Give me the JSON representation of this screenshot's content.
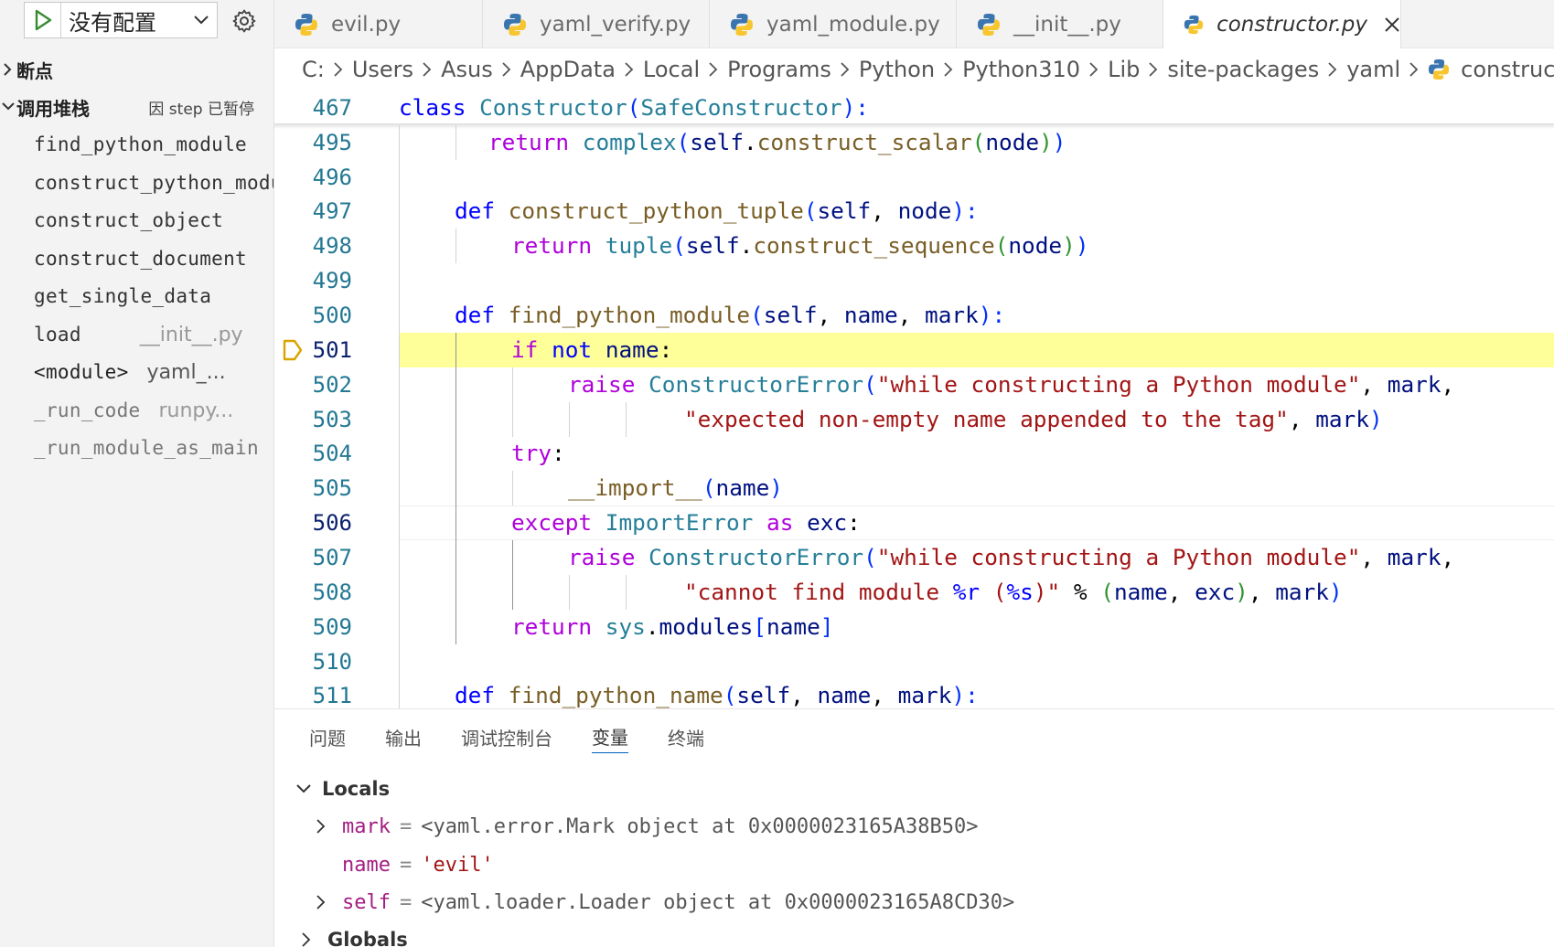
{
  "debug_toolbar": {
    "config_label": "没有配置"
  },
  "sidebar": {
    "breakpoints_label": "断点",
    "callstack_label": "调用堆栈",
    "paused_label": "因 step 已暂停",
    "frames": [
      {
        "fn": "find_python_module",
        "file": ""
      },
      {
        "fn": "construct_python_module",
        "file": ""
      },
      {
        "fn": "construct_object",
        "file": ""
      },
      {
        "fn": "construct_document",
        "file": ""
      },
      {
        "fn": "get_single_data",
        "file": ""
      },
      {
        "fn": "load",
        "file": "__init__.py"
      },
      {
        "fn": "<module>",
        "file": "yaml_..."
      },
      {
        "fn": "_run_code",
        "file": "runpy..."
      },
      {
        "fn": "_run_module_as_main",
        "file": ""
      }
    ]
  },
  "tabs": [
    {
      "label": "evil.py"
    },
    {
      "label": "yaml_verify.py"
    },
    {
      "label": "yaml_module.py"
    },
    {
      "label": "__init__.py"
    },
    {
      "label": "constructor.py"
    }
  ],
  "breadcrumb": [
    "C:",
    "Users",
    "Asus",
    "AppData",
    "Local",
    "Programs",
    "Python",
    "Python310",
    "Lib",
    "site-packages",
    "yaml",
    "constructor.py"
  ],
  "editor": {
    "sticky_line_number": "467",
    "line_numbers": [
      "495",
      "496",
      "497",
      "498",
      "499",
      "500",
      "501",
      "502",
      "503",
      "504",
      "505",
      "506",
      "507",
      "508",
      "509",
      "510",
      "511"
    ],
    "current_line": "501",
    "sticky": {
      "kw": "class",
      "cls": "Constructor",
      "open": "(",
      "base": "SafeConstructor",
      "close": "):"
    },
    "l495": {
      "ret": "return",
      "fn1": "complex",
      "o1": "(",
      "self": "self",
      "dot": ".",
      "fn2": "construct_scalar",
      "o2": "(",
      "arg": "node",
      "c2": ")",
      "c1": ")"
    },
    "l497": {
      "kw": "def",
      "fn": "construct_python_tuple",
      "o": "(",
      "p1": "self",
      "sep": ", ",
      "p2": "node",
      "c": "):"
    },
    "l498": {
      "ret": "return",
      "fn1": "tuple",
      "o1": "(",
      "self": "self",
      "dot": ".",
      "fn2": "construct_sequence",
      "o2": "(",
      "arg": "node",
      "c2": ")",
      "c1": ")"
    },
    "l500": {
      "kw": "def",
      "fn": "find_python_module",
      "o": "(",
      "p1": "self",
      "sep1": ", ",
      "p2": "name",
      "sep2": ", ",
      "p3": "mark",
      "c": "):"
    },
    "l501": {
      "kw": "if",
      "not": "not",
      "var": "name",
      "colon": ":"
    },
    "l502": {
      "kw": "raise",
      "cls": "ConstructorError",
      "o": "(",
      "str": "\"while constructing a Python module\"",
      "sep": ", ",
      "var": "mark",
      "tail": ","
    },
    "l503": {
      "str": "\"expected non-empty name appended to the tag\"",
      "sep": ", ",
      "var": "mark",
      "c": ")"
    },
    "l504": {
      "kw": "try",
      "colon": ":"
    },
    "l505": {
      "fn": "__import__",
      "o": "(",
      "var": "name",
      "c": ")"
    },
    "l506": {
      "kw": "except",
      "cls": "ImportError",
      "as": "as",
      "var": "exc",
      "colon": ":"
    },
    "l507": {
      "kw": "raise",
      "cls": "ConstructorError",
      "o": "(",
      "str": "\"while constructing a Python module\"",
      "sep": ", ",
      "var": "mark",
      "tail": ","
    },
    "l508": {
      "str": "\"cannot find module ",
      "fmt1": "%r",
      "sp": " (",
      "fmt2": "%s",
      "strend": ")\"",
      "pct": " % ",
      "o": "(",
      "v1": "name",
      "sep": ", ",
      "v2": "exc",
      "c": ")",
      "sep2": ", ",
      "v3": "mark",
      "c2": ")"
    },
    "l509": {
      "kw": "return",
      "mod": "sys",
      "dot": ".",
      "attr": "modules",
      "o": "[",
      "var": "name",
      "c": "]"
    },
    "l511": {
      "kw": "def",
      "fn": "find_python_name",
      "o": "(",
      "p1": "self",
      "sep1": ", ",
      "p2": "name",
      "sep2": ", ",
      "p3": "mark",
      "c": "):"
    }
  },
  "panel": {
    "tabs": [
      "问题",
      "输出",
      "调试控制台",
      "变量",
      "终端"
    ],
    "active_tab": "变量",
    "locals_label": "Locals",
    "globals_label": "Globals",
    "variables": [
      {
        "name": "mark",
        "eq": "=",
        "value": "<yaml.error.Mark object at 0x0000023165A38B50>"
      },
      {
        "name": "name",
        "eq": "=",
        "value": "'evil'"
      },
      {
        "name": "self",
        "eq": "=",
        "value": "<yaml.loader.Loader object at 0x0000023165A8CD30>"
      }
    ]
  },
  "colors": {
    "keyword": "#0000ff",
    "control": "#af00db",
    "class": "#267f99",
    "function": "#795e26",
    "string": "#a31515",
    "variable": "#001080",
    "current_line_highlight": "#ffff99",
    "debug_arrow": "#d9a400",
    "run_green": "#388a34"
  },
  "icons": {
    "run": "play-icon",
    "settings": "gear-icon",
    "file": "python-file-icon",
    "close": "close-icon",
    "debug_pointer": "debug-stackframe-icon"
  }
}
